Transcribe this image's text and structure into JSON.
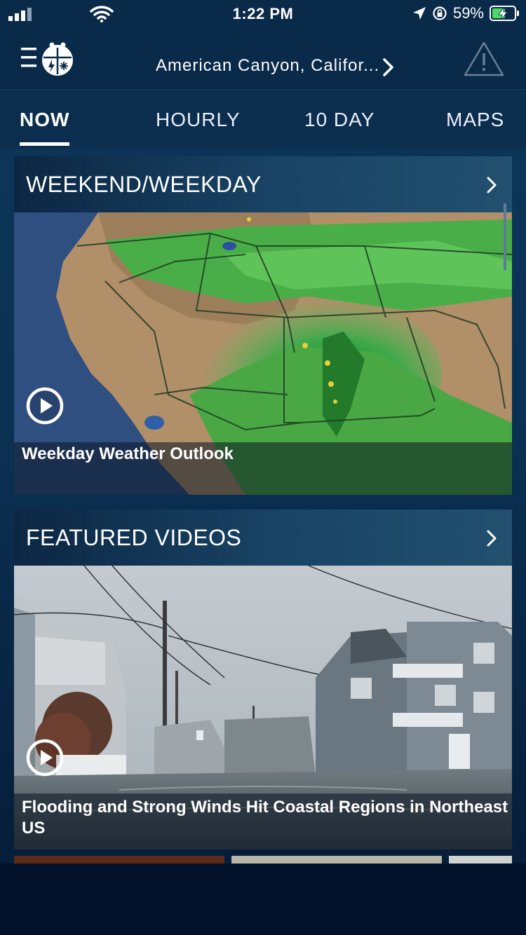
{
  "status_bar": {
    "time": "1:22 PM",
    "battery_percent": "59%",
    "battery_level": 0.59,
    "icons": [
      "signal-icon",
      "wifi-icon",
      "location-arrow-icon",
      "rotation-lock-icon",
      "battery-charging-icon"
    ]
  },
  "header": {
    "location": "American Canyon, Califor...",
    "icons": [
      "menu-icon",
      "app-logo-icon",
      "chevron-right-icon",
      "alert-triangle-icon"
    ]
  },
  "tabs": [
    {
      "label": "NOW",
      "active": true
    },
    {
      "label": "HOURLY",
      "active": false
    },
    {
      "label": "10 DAY",
      "active": false
    },
    {
      "label": "MAPS",
      "active": false
    }
  ],
  "cards": [
    {
      "title": "WEEKEND/WEEKDAY",
      "video_caption": "Weekday Weather Outlook",
      "media": "radar-map-video"
    },
    {
      "title": "FEATURED VIDEOS",
      "video_caption": "Flooding and Strong Winds Hit Coastal Regions in Northeast US",
      "media": "flooded-street-video"
    }
  ],
  "colors": {
    "background": "#0b3153",
    "header": "#0a2a4a",
    "accent_white": "#ffffff",
    "battery_green": "#4cd964"
  }
}
